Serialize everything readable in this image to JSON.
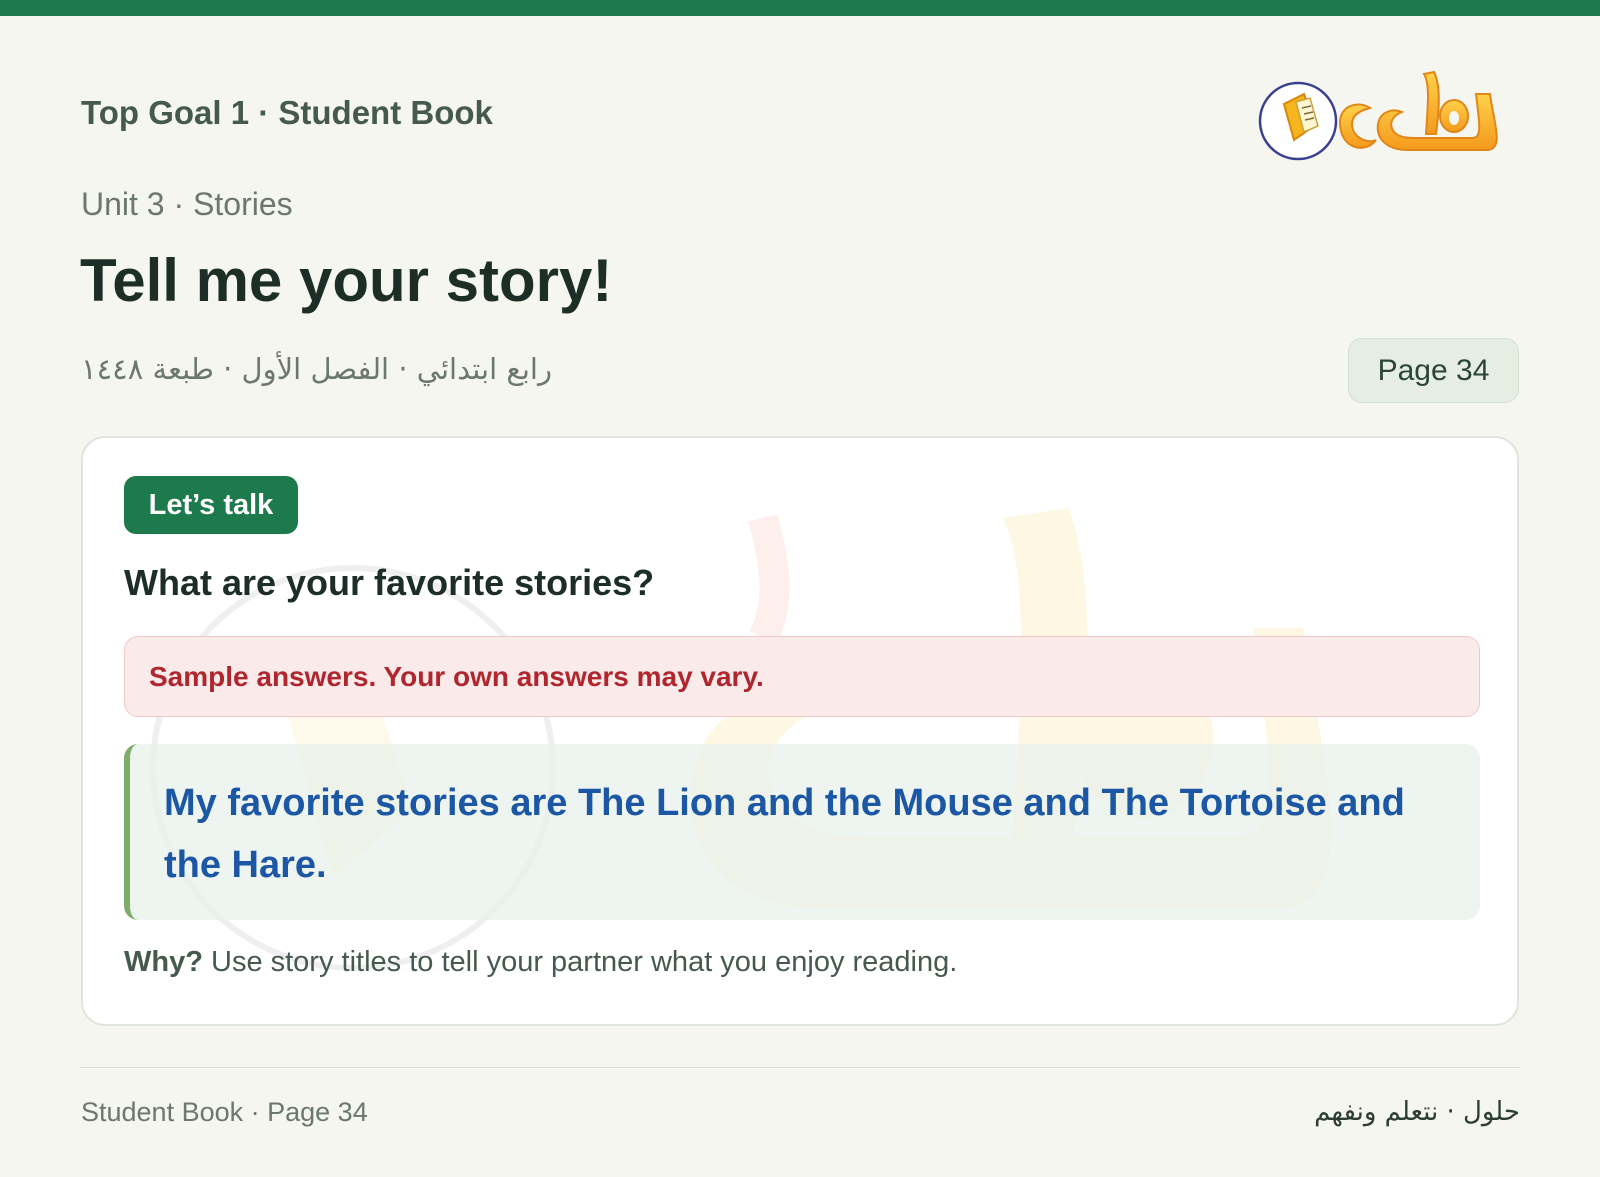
{
  "header": {
    "book_title": "Top Goal 1 · Student Book",
    "unit": "Unit 3 · Stories",
    "page_title": "Tell me your story!",
    "arabic_meta": "رابع ابتدائي · الفصل الأول · طبعة ١٤٤٨",
    "page_badge": "Page 34",
    "logo_text": "حلول"
  },
  "card": {
    "tag": "Let’s talk",
    "question": "What are your favorite stories?",
    "note": "Sample answers. Your own answers may vary.",
    "answer": "My favorite stories are The Lion and the Mouse and The Tortoise and the Hare.",
    "why_label": "Why?",
    "why_text": " Use story titles to tell your partner what you enjoy reading."
  },
  "footer": {
    "left": "Student Book · Page 34",
    "right": "حلول · نتعلم ونفهم"
  },
  "colors": {
    "top_bar": "#1d7a4c",
    "pill": "#1d7a4c",
    "answer_text": "#1b57a4",
    "note_text": "#b0262e",
    "answer_border": "#7fae6b"
  }
}
